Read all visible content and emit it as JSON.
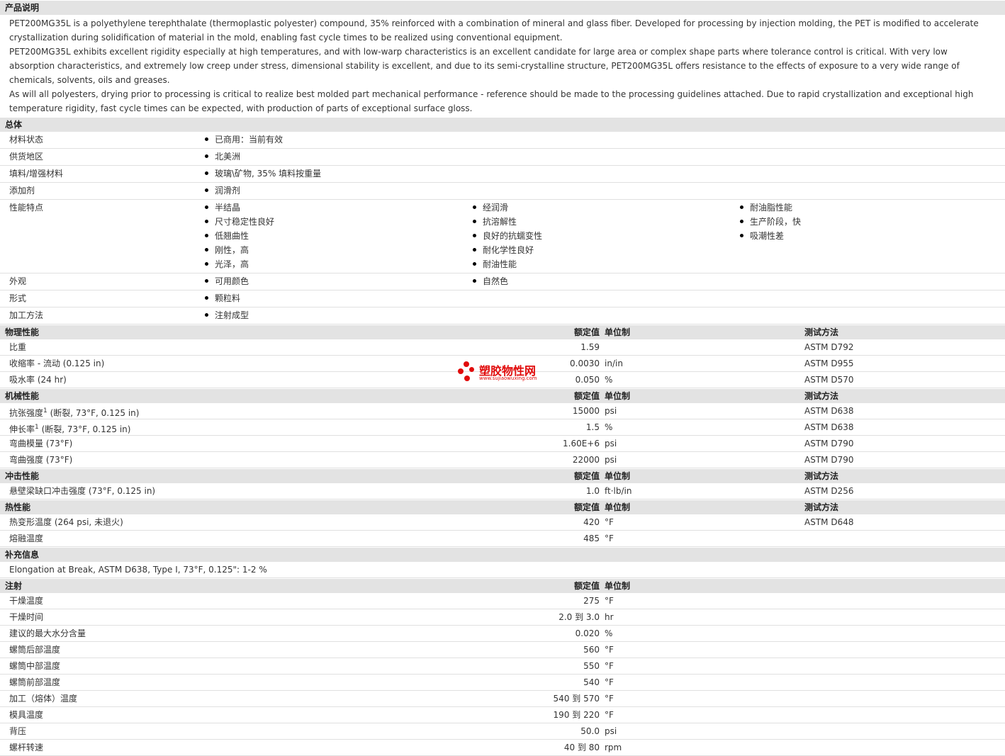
{
  "description": {
    "title": "产品说明",
    "paragraphs": [
      "PET200MG35L is a polyethylene terephthalate (thermoplastic polyester) compound, 35% reinforced with a combination of mineral and glass fiber. Developed for processing by injection molding, the PET is modified to accelerate crystallization during solidification of material in the mold, enabling fast cycle times to be realized using conventional equipment.",
      "PET200MG35L exhibits excellent rigidity especially at high temperatures, and with low-warp characteristics is an excellent candidate for large area or complex shape parts where tolerance control is critical. With very low absorption characteristics, and extremely low creep under stress, dimensional stability is excellent, and due to its semi-crystalline structure, PET200MG35L offers resistance to the effects of exposure to a very wide range of chemicals, solvents, oils and greases.",
      "As will all polyesters, drying prior to processing is critical to realize best molded part mechanical performance - reference should be made to the processing guidelines attached. Due to rapid crystallization and exceptional high temperature rigidity, fast cycle times can be expected, with production of parts of exceptional surface gloss."
    ]
  },
  "general": {
    "title": "总体",
    "rows": [
      {
        "label": "材料状态",
        "cols": [
          [
            "已商用：当前有效"
          ]
        ]
      },
      {
        "label": "供货地区",
        "cols": [
          [
            "北美洲"
          ]
        ]
      },
      {
        "label": "填料/增强材料",
        "cols": [
          [
            "玻璃\\矿物, 35% 填料按重量"
          ]
        ]
      },
      {
        "label": "添加剂",
        "cols": [
          [
            "润滑剂"
          ]
        ]
      },
      {
        "label": "性能特点",
        "cols": [
          [
            "半结晶",
            "尺寸稳定性良好",
            "低翘曲性",
            "刚性，高",
            "光泽，高"
          ],
          [
            "经润滑",
            "抗溶解性",
            "良好的抗蠕变性",
            "耐化学性良好",
            "耐油性能"
          ],
          [
            "耐油脂性能",
            "生产阶段，快",
            "吸潮性差"
          ]
        ]
      },
      {
        "label": "外观",
        "cols": [
          [
            "可用颜色"
          ],
          [
            "自然色"
          ]
        ]
      },
      {
        "label": "形式",
        "cols": [
          [
            "颗粒料"
          ]
        ]
      },
      {
        "label": "加工方法",
        "cols": [
          [
            "注射成型"
          ]
        ]
      }
    ]
  },
  "headers": {
    "value": "额定值",
    "unit": "单位制",
    "test": "测试方法"
  },
  "physical": {
    "title": "物理性能",
    "rows": [
      {
        "label": "比重",
        "note": "",
        "value": "1.59",
        "unit": "",
        "test": "ASTM D792"
      },
      {
        "label": "收缩率",
        "note": " - 流动 (0.125 in)",
        "value": "0.0030",
        "unit": "in/in",
        "test": "ASTM D955"
      },
      {
        "label": "吸水率",
        "note": " (24 hr)",
        "value": "0.050",
        "unit": "%",
        "test": "ASTM D570"
      }
    ]
  },
  "mechanical": {
    "title": "机械性能",
    "rows": [
      {
        "label": "抗张强度",
        "sup": "1",
        "note": " (断裂, 73°F, 0.125 in)",
        "value": "15000",
        "unit": "psi",
        "test": "ASTM D638"
      },
      {
        "label": "伸长率",
        "sup": "1",
        "note": " (断裂, 73°F, 0.125 in)",
        "value": "1.5",
        "unit": "%",
        "test": "ASTM D638"
      },
      {
        "label": "弯曲模量",
        "sup": "",
        "note": " (73°F)",
        "value": "1.60E+6",
        "unit": "psi",
        "test": "ASTM D790"
      },
      {
        "label": "弯曲强度",
        "sup": "",
        "note": " (73°F)",
        "value": "22000",
        "unit": "psi",
        "test": "ASTM D790"
      }
    ]
  },
  "impact": {
    "title": "冲击性能",
    "rows": [
      {
        "label": "悬壁梁缺口冲击强度",
        "note": " (73°F, 0.125 in)",
        "value": "1.0",
        "unit": "ft·lb/in",
        "test": "ASTM D256"
      }
    ]
  },
  "thermal": {
    "title": "热性能",
    "rows": [
      {
        "label": "热变形温度",
        "note": " (264 psi, 未退火)",
        "value": "420",
        "unit": "°F",
        "test": "ASTM D648"
      },
      {
        "label": "熔融温度",
        "note": "",
        "value": "485",
        "unit": "°F",
        "test": ""
      }
    ]
  },
  "supplement": {
    "title": "补充信息",
    "text": "Elongation at Break, ASTM D638, Type I, 73°F, 0.125\": 1-2 %"
  },
  "injection": {
    "title": "注射",
    "rows": [
      {
        "label": "干燥温度",
        "value": "275",
        "unit": "°F"
      },
      {
        "label": "干燥时间",
        "value": "2.0 到  3.0",
        "unit": "hr"
      },
      {
        "label": "建议的最大水分含量",
        "value": "0.020",
        "unit": "%"
      },
      {
        "label": "螺筒后部温度",
        "value": "560",
        "unit": "°F"
      },
      {
        "label": "螺筒中部温度",
        "value": "550",
        "unit": "°F"
      },
      {
        "label": "螺筒前部温度",
        "value": "540",
        "unit": "°F"
      },
      {
        "label": "加工（熔体）温度",
        "value": "540 到  570",
        "unit": "°F"
      },
      {
        "label": "模具温度",
        "value": "190 到  220",
        "unit": "°F"
      },
      {
        "label": "背压",
        "value": "50.0",
        "unit": "psi"
      },
      {
        "label": "螺杆转速",
        "value": "40 到  80",
        "unit": "rpm"
      }
    ]
  },
  "watermark": {
    "name": "塑胶物性网",
    "url": "www.sujiaowuxing.com",
    "color": "#e10a0a"
  }
}
